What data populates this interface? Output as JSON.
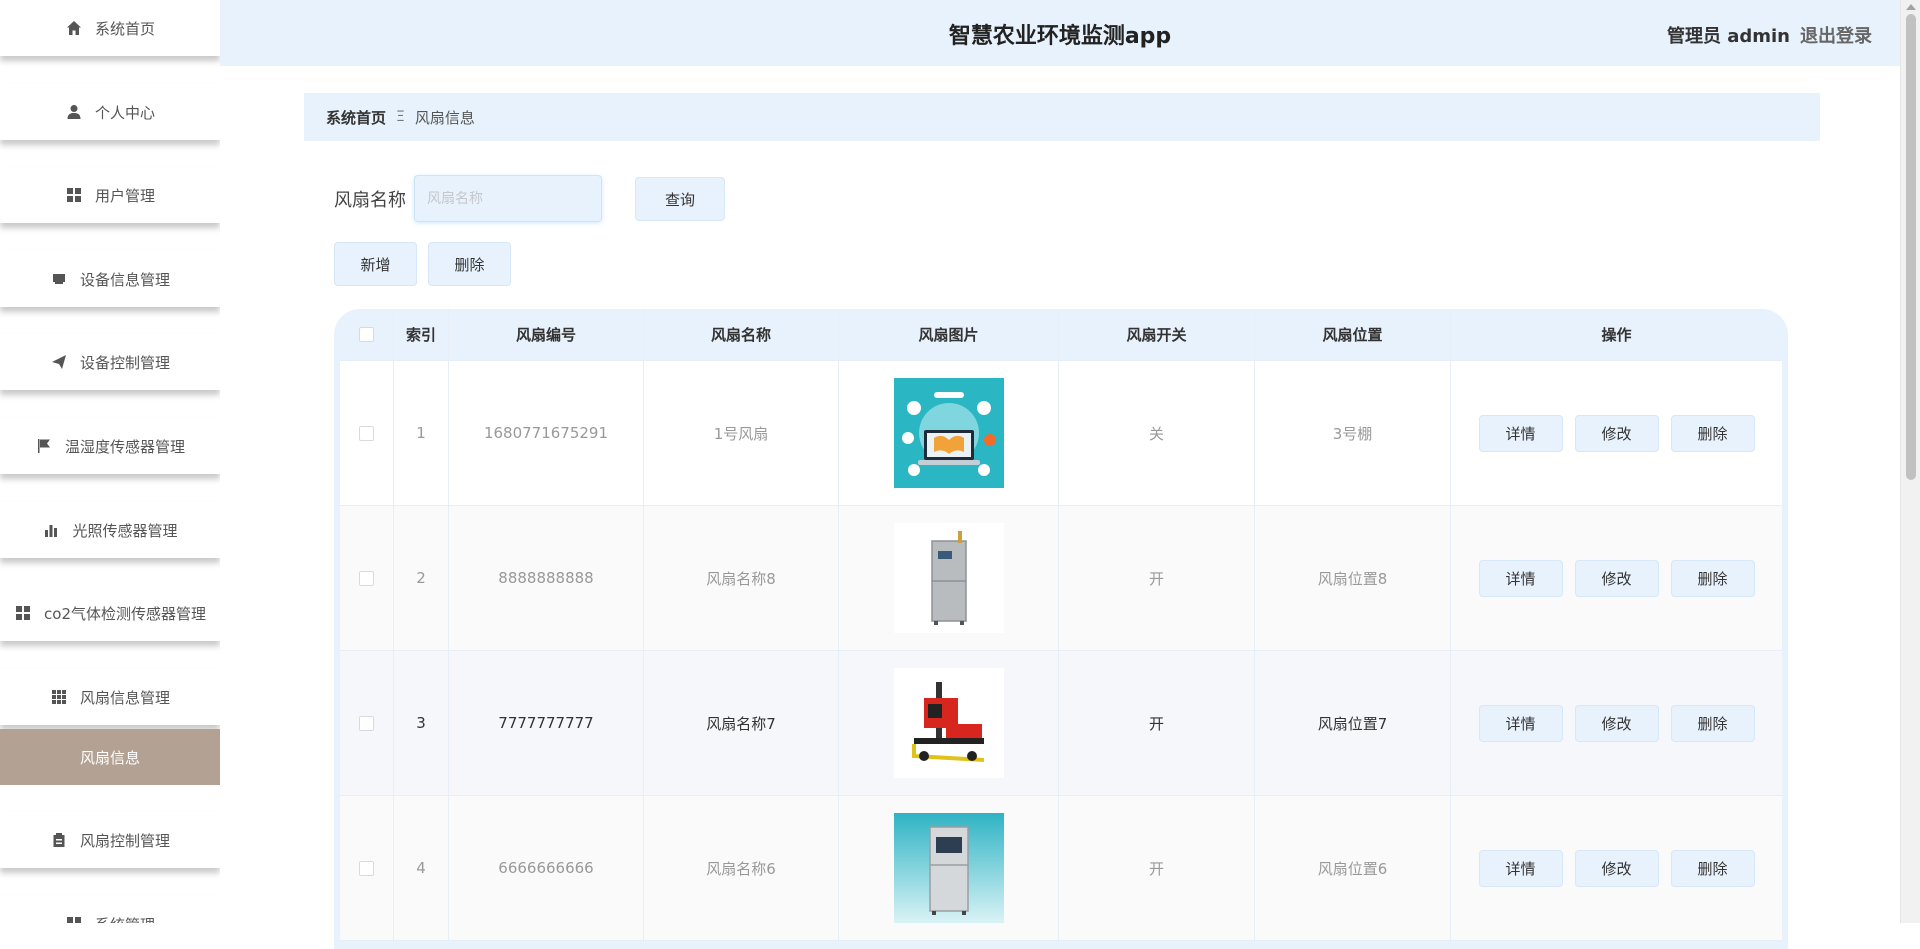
{
  "header": {
    "title": "智慧农业环境监测app",
    "admin": "管理员 admin",
    "logout": "退出登录"
  },
  "sidebar": {
    "items": [
      {
        "label": "系统首页",
        "icon": "home-icon"
      },
      {
        "label": "个人中心",
        "icon": "user-icon"
      },
      {
        "label": "用户管理",
        "icon": "grid-icon"
      },
      {
        "label": "设备信息管理",
        "icon": "device-icon"
      },
      {
        "label": "设备控制管理",
        "icon": "send-icon"
      },
      {
        "label": "温湿度传感器管理",
        "icon": "flag-icon"
      },
      {
        "label": "光照传感器管理",
        "icon": "bar-chart-icon"
      },
      {
        "label": "co2气体检测传感器管理",
        "icon": "grid-icon"
      },
      {
        "label": "风扇信息管理",
        "icon": "apps-icon"
      },
      {
        "label": "风扇控制管理",
        "icon": "clipboard-icon"
      },
      {
        "label": "系统管理",
        "icon": "grid-icon"
      }
    ],
    "active_sub": "风扇信息"
  },
  "breadcrumb": {
    "home": "系统首页",
    "separator": "Ξ",
    "current": "风扇信息"
  },
  "search": {
    "label": "风扇名称",
    "placeholder": "风扇名称",
    "query_label": "查询"
  },
  "actions": {
    "add_label": "新增",
    "delete_label": "删除"
  },
  "table": {
    "headers": [
      "索引",
      "风扇编号",
      "风扇名称",
      "风扇图片",
      "风扇开关",
      "风扇位置",
      "操作"
    ],
    "op_labels": {
      "detail": "详情",
      "edit": "修改",
      "delete": "删除"
    },
    "rows": [
      {
        "index": "1",
        "number": "1680771675291",
        "name": "1号风扇",
        "image": "online-education-image",
        "switch": "关",
        "position": "3号棚"
      },
      {
        "index": "2",
        "number": "8888888888",
        "name": "风扇名称8",
        "image": "gray-cabinet-image",
        "switch": "开",
        "position": "风扇位置8"
      },
      {
        "index": "3",
        "number": "7777777777",
        "name": "风扇名称7",
        "image": "red-forklift-image",
        "switch": "开",
        "position": "风扇位置7"
      },
      {
        "index": "4",
        "number": "6666666666",
        "name": "风扇名称6",
        "image": "analyzer-cabinet-image",
        "switch": "开",
        "position": "风扇位置6"
      }
    ]
  },
  "colors": {
    "accent_bg": "#e8f2fc",
    "active_menu": "#b3a293"
  }
}
